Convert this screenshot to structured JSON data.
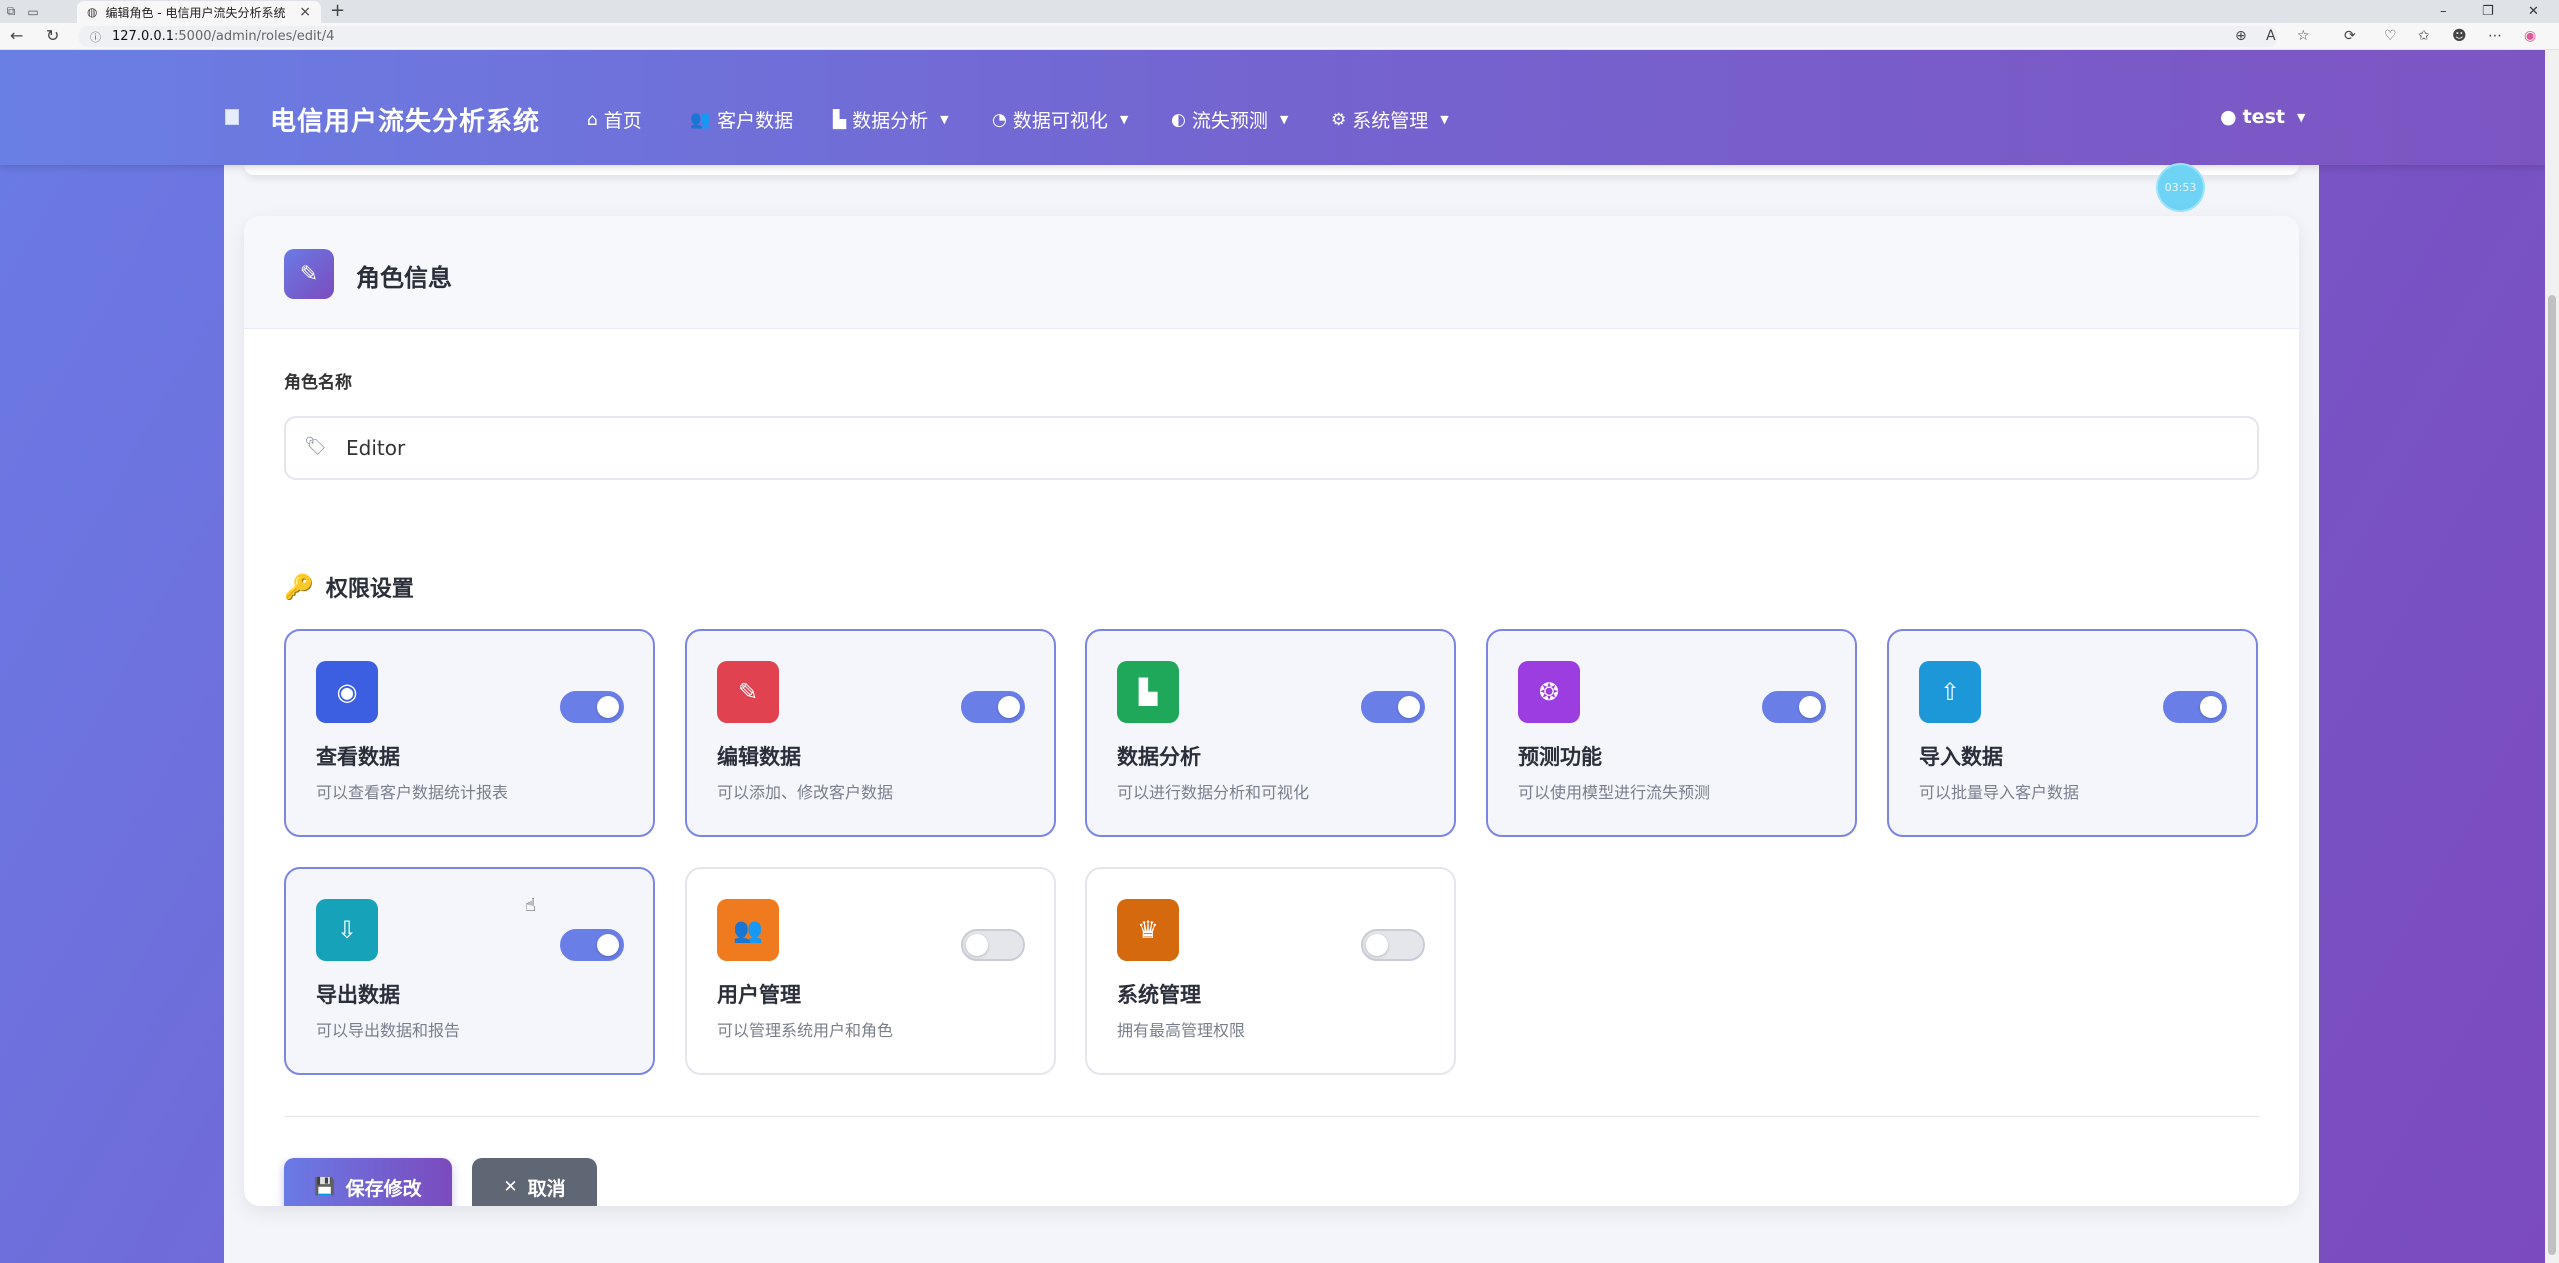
{
  "browser": {
    "tab_title": "编辑角色 - 电信用户流失分析系统",
    "url_host": "127.0.0.1",
    "url_path": ":5000/admin/roles/edit/4",
    "new_tab": "+",
    "minimize": "–",
    "restore": "❐",
    "close": "✕"
  },
  "navbar": {
    "brand": "电信用户流失分析系统",
    "items": [
      {
        "label": "首页",
        "icon": "home-icon"
      },
      {
        "label": "客户数据",
        "icon": "users-icon"
      },
      {
        "label": "数据分析",
        "icon": "chart-icon"
      },
      {
        "label": "数据可视化",
        "icon": "pie-icon"
      },
      {
        "label": "流失预测",
        "icon": "brain-icon"
      },
      {
        "label": "系统管理",
        "icon": "gear-icon"
      }
    ],
    "user": "test"
  },
  "timer": "03:53",
  "card": {
    "title": "角色信息",
    "name_label": "角色名称",
    "role_name": "Editor",
    "permissions_title": "权限设置",
    "permissions": [
      {
        "title": "查看数据",
        "desc": "可以查看客户数据统计报表",
        "enabled": true,
        "color": "#3b5fe0",
        "icon": "eye-icon"
      },
      {
        "title": "编辑数据",
        "desc": "可以添加、修改客户数据",
        "enabled": true,
        "color": "#e0434f",
        "icon": "edit-icon"
      },
      {
        "title": "数据分析",
        "desc": "可以进行数据分析和可视化",
        "enabled": true,
        "color": "#1fa75a",
        "icon": "chart-icon"
      },
      {
        "title": "预测功能",
        "desc": "可以使用模型进行流失预测",
        "enabled": true,
        "color": "#9b3de0",
        "icon": "brain-icon"
      },
      {
        "title": "导入数据",
        "desc": "可以批量导入客户数据",
        "enabled": true,
        "color": "#1c97d8",
        "icon": "upload-icon"
      },
      {
        "title": "导出数据",
        "desc": "可以导出数据和报告",
        "enabled": true,
        "color": "#16a2b8",
        "icon": "download-icon"
      },
      {
        "title": "用户管理",
        "desc": "可以管理系统用户和角色",
        "enabled": false,
        "color": "#f07a1e",
        "icon": "users-cog-icon"
      },
      {
        "title": "系统管理",
        "desc": "拥有最高管理权限",
        "enabled": false,
        "color": "#d4690d",
        "icon": "crown-icon"
      }
    ],
    "save_label": "保存修改",
    "cancel_label": "取消"
  }
}
